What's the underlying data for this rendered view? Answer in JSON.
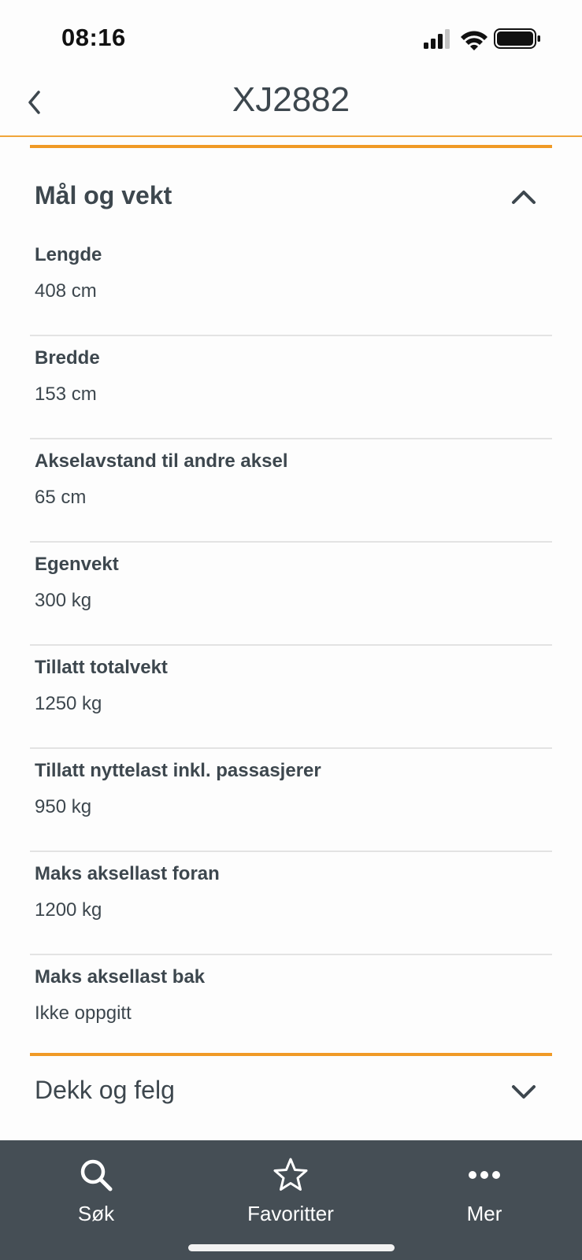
{
  "status": {
    "time": "08:16"
  },
  "nav": {
    "title": "XJ2882",
    "back_icon": "chevron-left-icon"
  },
  "sections": {
    "dimensions": {
      "title": "Mål og vekt",
      "expanded": true,
      "items": [
        {
          "label": "Lengde",
          "value": "408 cm"
        },
        {
          "label": "Bredde",
          "value": "153 cm"
        },
        {
          "label": "Akselavstand til andre aksel",
          "value": "65 cm"
        },
        {
          "label": "Egenvekt",
          "value": "300 kg"
        },
        {
          "label": "Tillatt totalvekt",
          "value": "1250 kg"
        },
        {
          "label": "Tillatt nyttelast inkl. passasjerer",
          "value": "950 kg"
        },
        {
          "label": "Maks aksellast foran",
          "value": "1200 kg"
        },
        {
          "label": "Maks aksellast bak",
          "value": "Ikke oppgitt"
        }
      ]
    },
    "tires": {
      "title": "Dekk og felg",
      "expanded": false
    }
  },
  "tabbar": {
    "search": {
      "label": "Søk",
      "icon": "search-icon"
    },
    "favorites": {
      "label": "Favoritter",
      "icon": "star-icon"
    },
    "more": {
      "label": "Mer",
      "icon": "more-icon"
    }
  },
  "colors": {
    "accent": "#f09a26",
    "text": "#3d474e",
    "tabbar": "#454e55"
  }
}
